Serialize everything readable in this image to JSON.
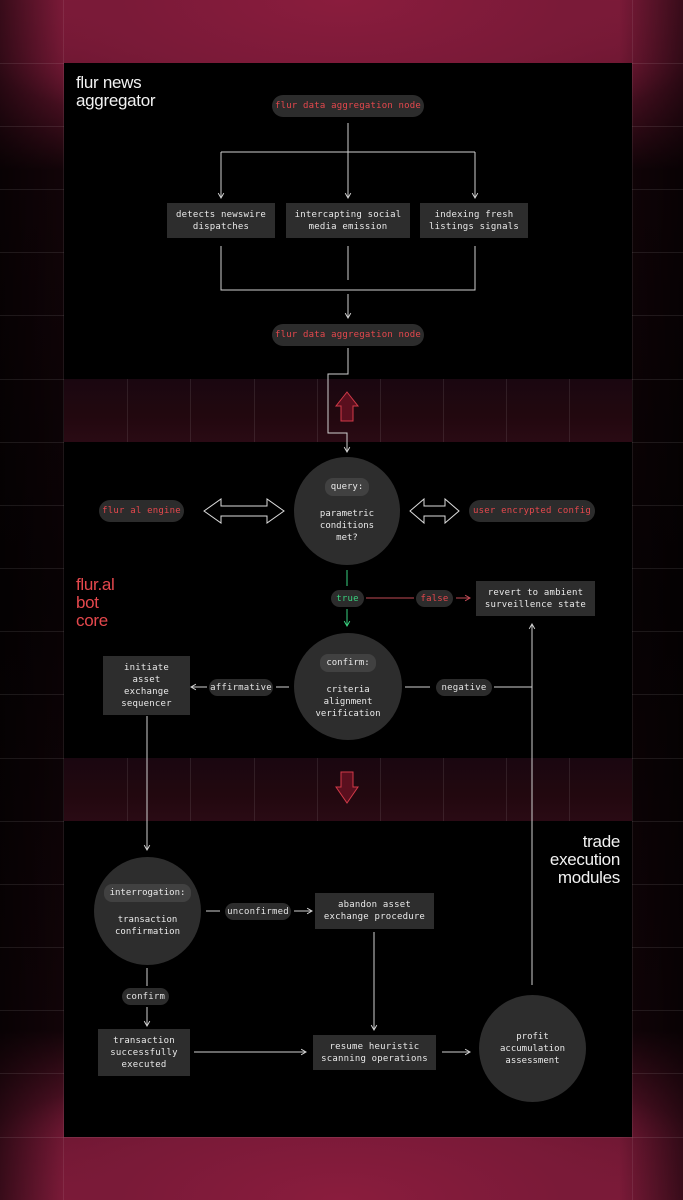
{
  "sections": {
    "news": {
      "title": "flur news\naggregator"
    },
    "core": {
      "title": "flur.al\nbot\ncore"
    },
    "trade": {
      "title": "trade\nexecution\nmodules"
    }
  },
  "news_aggregator": {
    "top_node": "flur data aggregation node",
    "sources": [
      "detects newswire\ndispatches",
      "intercapting social\nmedia emission",
      "indexing fresh\nlistings signals"
    ],
    "bottom_node": "flur data aggregation node"
  },
  "bot_core": {
    "left_node": "flur al engine",
    "right_node": "user encrypted config",
    "query": {
      "tag": "query:",
      "text": "parametric\nconditions\nmet?"
    },
    "true_label": "true",
    "false_label": "false",
    "revert_box": "revert to ambient\nsurveillence state",
    "confirm": {
      "tag": "confirm:",
      "text": "criteria\nalignment\nverification"
    },
    "affirmative_label": "affirmative",
    "negative_label": "negative",
    "initiate_box": "initiate\nasset\nexchange\nsequencer"
  },
  "trade_execution": {
    "interrogation": {
      "tag": "interrogation:",
      "text": "transaction\nconfirmation"
    },
    "unconfirmed_label": "unconfirmed",
    "abandon_box": "abandon asset\nexchange procedure",
    "confirm_label": "confirm",
    "success_box": "transaction\nsuccessfully\nexecuted",
    "resume_box": "resume heuristic\nscanning operations",
    "profit_circle": "profit\naccumulation\nassessment"
  },
  "colors": {
    "accent_red": "#e5484d",
    "true_green": "#39d27f",
    "node_fill": "#2d2d2d",
    "frame_crimson": "#7d1a38"
  },
  "icons": {
    "band_1": "up-arrow-outline",
    "band_2": "down-arrow-outline",
    "core_left_link": "double-headed-arrow-outline",
    "core_right_link": "double-headed-arrow-outline"
  }
}
